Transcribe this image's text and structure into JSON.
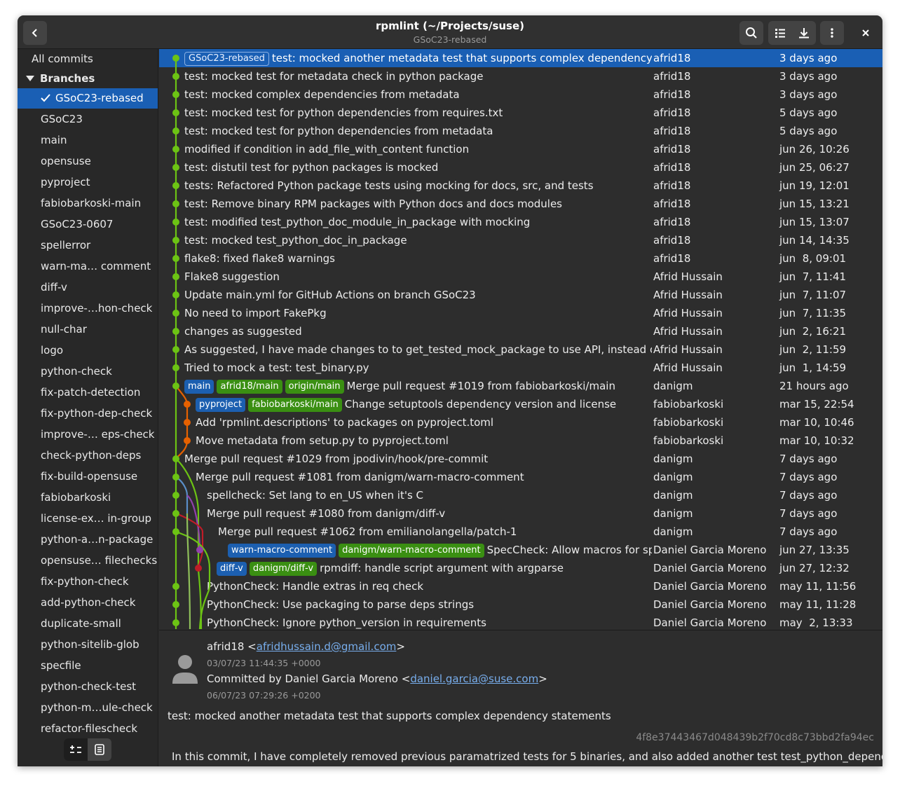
{
  "window": {
    "title": "rpmlint (~/Projects/suse)",
    "subtitle": "GSoC23-rebased"
  },
  "sidebar": {
    "all_commits": "All commits",
    "branches_label": "Branches",
    "branches": [
      {
        "name": "GSoC23-rebased",
        "selected": true
      },
      {
        "name": "GSoC23"
      },
      {
        "name": "main"
      },
      {
        "name": "opensuse"
      },
      {
        "name": "pyproject"
      },
      {
        "name": "fabiobarkoski-main"
      },
      {
        "name": "GSoC23-0607"
      },
      {
        "name": "spellerror"
      },
      {
        "name": "warn-ma… comment"
      },
      {
        "name": "diff-v"
      },
      {
        "name": "improve-…hon-check"
      },
      {
        "name": "null-char"
      },
      {
        "name": "logo"
      },
      {
        "name": "python-check"
      },
      {
        "name": "fix-patch-detection"
      },
      {
        "name": "fix-python-dep-check"
      },
      {
        "name": "improve-… eps-check"
      },
      {
        "name": "check-python-deps"
      },
      {
        "name": "fix-build-opensuse"
      },
      {
        "name": "fabiobarkoski"
      },
      {
        "name": "license-ex… in-group"
      },
      {
        "name": "python-a…n-package"
      },
      {
        "name": "opensuse… filechecks"
      },
      {
        "name": "fix-python-check"
      },
      {
        "name": "add-python-check"
      },
      {
        "name": "duplicate-small"
      },
      {
        "name": "python-sitelib-glob"
      },
      {
        "name": "specfile"
      },
      {
        "name": "python-check-test"
      },
      {
        "name": "python-m…ule-check"
      },
      {
        "name": "refactor-filescheck"
      }
    ]
  },
  "commits": [
    {
      "tags": [
        {
          "text": "GSoC23-rebased",
          "style": "blueborder"
        }
      ],
      "message": "test: mocked another metadata test that supports complex dependency statements",
      "author": "afrid18",
      "date": "3 days ago",
      "selected": true
    },
    {
      "tags": [],
      "message": "test: mocked test for metadata check in python package",
      "author": "afrid18",
      "date": "3 days ago"
    },
    {
      "tags": [],
      "message": "test: mocked complex dependencies from metadata",
      "author": "afrid18",
      "date": "3 days ago"
    },
    {
      "tags": [],
      "message": "test: mocked test for python dependencies from requires.txt",
      "author": "afrid18",
      "date": "5 days ago"
    },
    {
      "tags": [],
      "message": "test: mocked test for python dependencies from metadata",
      "author": "afrid18",
      "date": "5 days ago"
    },
    {
      "tags": [],
      "message": "modified if condition in add_file_with_content function",
      "author": "afrid18",
      "date": "jun 26, 10:26"
    },
    {
      "tags": [],
      "message": "test: distutil test for python packages is mocked",
      "author": "afrid18",
      "date": "jun 25, 06:27"
    },
    {
      "tags": [],
      "message": "tests: Refactored Python package tests using mocking for docs, src, and tests",
      "author": "afrid18",
      "date": "jun 19, 12:01"
    },
    {
      "tags": [],
      "message": "test: Remove binary RPM packages with Python docs and docs modules",
      "author": "afrid18",
      "date": "jun 15, 13:21"
    },
    {
      "tags": [],
      "message": "test: modified test_python_doc_module_in_package with mocking",
      "author": "afrid18",
      "date": "jun 15, 13:07"
    },
    {
      "tags": [],
      "message": "test: mocked test_python_doc_in_package",
      "author": "afrid18",
      "date": "jun 14, 14:35"
    },
    {
      "tags": [],
      "message": "flake8: fixed flake8 warnings",
      "author": "afrid18",
      "date": "jun  8, 09:01"
    },
    {
      "tags": [],
      "message": "Flake8 suggestion",
      "author": "Afrid Hussain",
      "date": "jun  7, 11:41"
    },
    {
      "tags": [],
      "message": "Update main.yml for GitHub Actions on branch GSoC23",
      "author": "Afrid Hussain",
      "date": "jun  7, 11:07"
    },
    {
      "tags": [],
      "message": "No need to import FakePkg",
      "author": "Afrid Hussain",
      "date": "jun  7, 11:35"
    },
    {
      "tags": [],
      "message": "changes as suggested",
      "author": "Afrid Hussain",
      "date": "jun  2, 16:21"
    },
    {
      "tags": [],
      "message": "As suggested, I have made changes to to get_tested_mock_package to use API, instead of just k",
      "author": "Afrid Hussain",
      "date": "jun  2, 11:59"
    },
    {
      "tags": [],
      "message": "Tried to mock a test: test_binary.py",
      "author": "Afrid Hussain",
      "date": "jun  1, 14:59"
    },
    {
      "tags": [
        {
          "text": "main",
          "style": "blue"
        },
        {
          "text": "afrid18/main",
          "style": "green"
        },
        {
          "text": "origin/main",
          "style": "green"
        }
      ],
      "message": "Merge pull request #1019 from fabiobarkoski/main",
      "author": "danigm",
      "date": "21 hours ago"
    },
    {
      "tags": [
        {
          "text": "pyproject",
          "style": "blue"
        },
        {
          "text": "fabiobarkoski/main",
          "style": "green"
        }
      ],
      "message": "Change setuptools dependency version and license",
      "author": "fabiobarkoski",
      "date": "mar 15, 22:54"
    },
    {
      "tags": [],
      "message": "Add 'rpmlint.descriptions' to packages on pyproject.toml",
      "author": "fabiobarkoski",
      "date": "mar 10, 10:46"
    },
    {
      "tags": [],
      "message": "Move metadata from setup.py to pyproject.toml",
      "author": "fabiobarkoski",
      "date": "mar 10, 10:32"
    },
    {
      "tags": [],
      "message": "Merge pull request #1029 from jpodivin/hook/pre-commit",
      "author": "danigm",
      "date": "7 days ago"
    },
    {
      "tags": [],
      "message": "Merge pull request #1081 from danigm/warn-macro-comment",
      "author": "danigm",
      "date": "7 days ago"
    },
    {
      "tags": [],
      "message": "spellcheck: Set lang to en_US when it's C",
      "author": "danigm",
      "date": "7 days ago"
    },
    {
      "tags": [],
      "message": "Merge pull request #1080 from danigm/diff-v",
      "author": "danigm",
      "date": "7 days ago"
    },
    {
      "tags": [],
      "message": "Merge pull request #1062 from emilianolangella/patch-1",
      "author": "danigm",
      "date": "7 days ago"
    },
    {
      "tags": [
        {
          "text": "warn-macro-comment",
          "style": "blue"
        },
        {
          "text": "danigm/warn-macro-comment",
          "style": "green"
        }
      ],
      "message": "SpecCheck: Allow macros for special",
      "author": "Daniel Garcia Moreno",
      "date": "jun 27, 13:35"
    },
    {
      "tags": [
        {
          "text": "diff-v",
          "style": "blue"
        },
        {
          "text": "danigm/diff-v",
          "style": "green"
        }
      ],
      "message": "rpmdiff: handle script argument with argparse",
      "author": "Daniel Garcia Moreno",
      "date": "jun 27, 12:32"
    },
    {
      "tags": [],
      "message": "PythonCheck: Handle extras in req check",
      "author": "Daniel Garcia Moreno",
      "date": "may 11, 11:56"
    },
    {
      "tags": [],
      "message": "PythonCheck: Use packaging to parse deps strings",
      "author": "Daniel Garcia Moreno",
      "date": "may 11, 11:28"
    },
    {
      "tags": [],
      "message": "PythonCheck: Ignore python_version in requirements",
      "author": "Daniel Garcia Moreno",
      "date": "may  2, 13:33"
    }
  ],
  "detail": {
    "author_name": "afrid18 <",
    "author_email": "afridhussain.d@gmail.com",
    "author_close": ">",
    "author_date": "03/07/23 11:44:35 +0000",
    "committer_prefix": "Committed by Daniel Garcia Moreno <",
    "committer_email": "daniel.garcia@suse.com",
    "committer_close": ">",
    "committer_date": "06/07/23 07:29:26 +0200",
    "subject": "test: mocked another metadata test that supports complex dependency statements",
    "hash": "4f8e37443467d048439b2f70cd8c73bbd2fa94ec",
    "body": "In this commit, I have completely removed previous paramatrized tests for 5 binaries, and also added another test test_python_dependencies_me"
  },
  "icons": {
    "back": "go-back-icon",
    "search": "search-icon",
    "list_view": "list-view-icon",
    "download": "download-icon",
    "menu": "kebab-menu-icon",
    "close": "close-icon",
    "compare": "compare-icon",
    "document": "document-icon",
    "avatar": "avatar-icon"
  },
  "colors": {
    "accent": "#1a5fb4",
    "graph_green": "#6cc314",
    "graph_orange": "#e66100",
    "graph_purple": "#9141ac",
    "graph_red": "#c01c28",
    "remote_tag": "#3a8f12",
    "link": "#78aeed"
  }
}
